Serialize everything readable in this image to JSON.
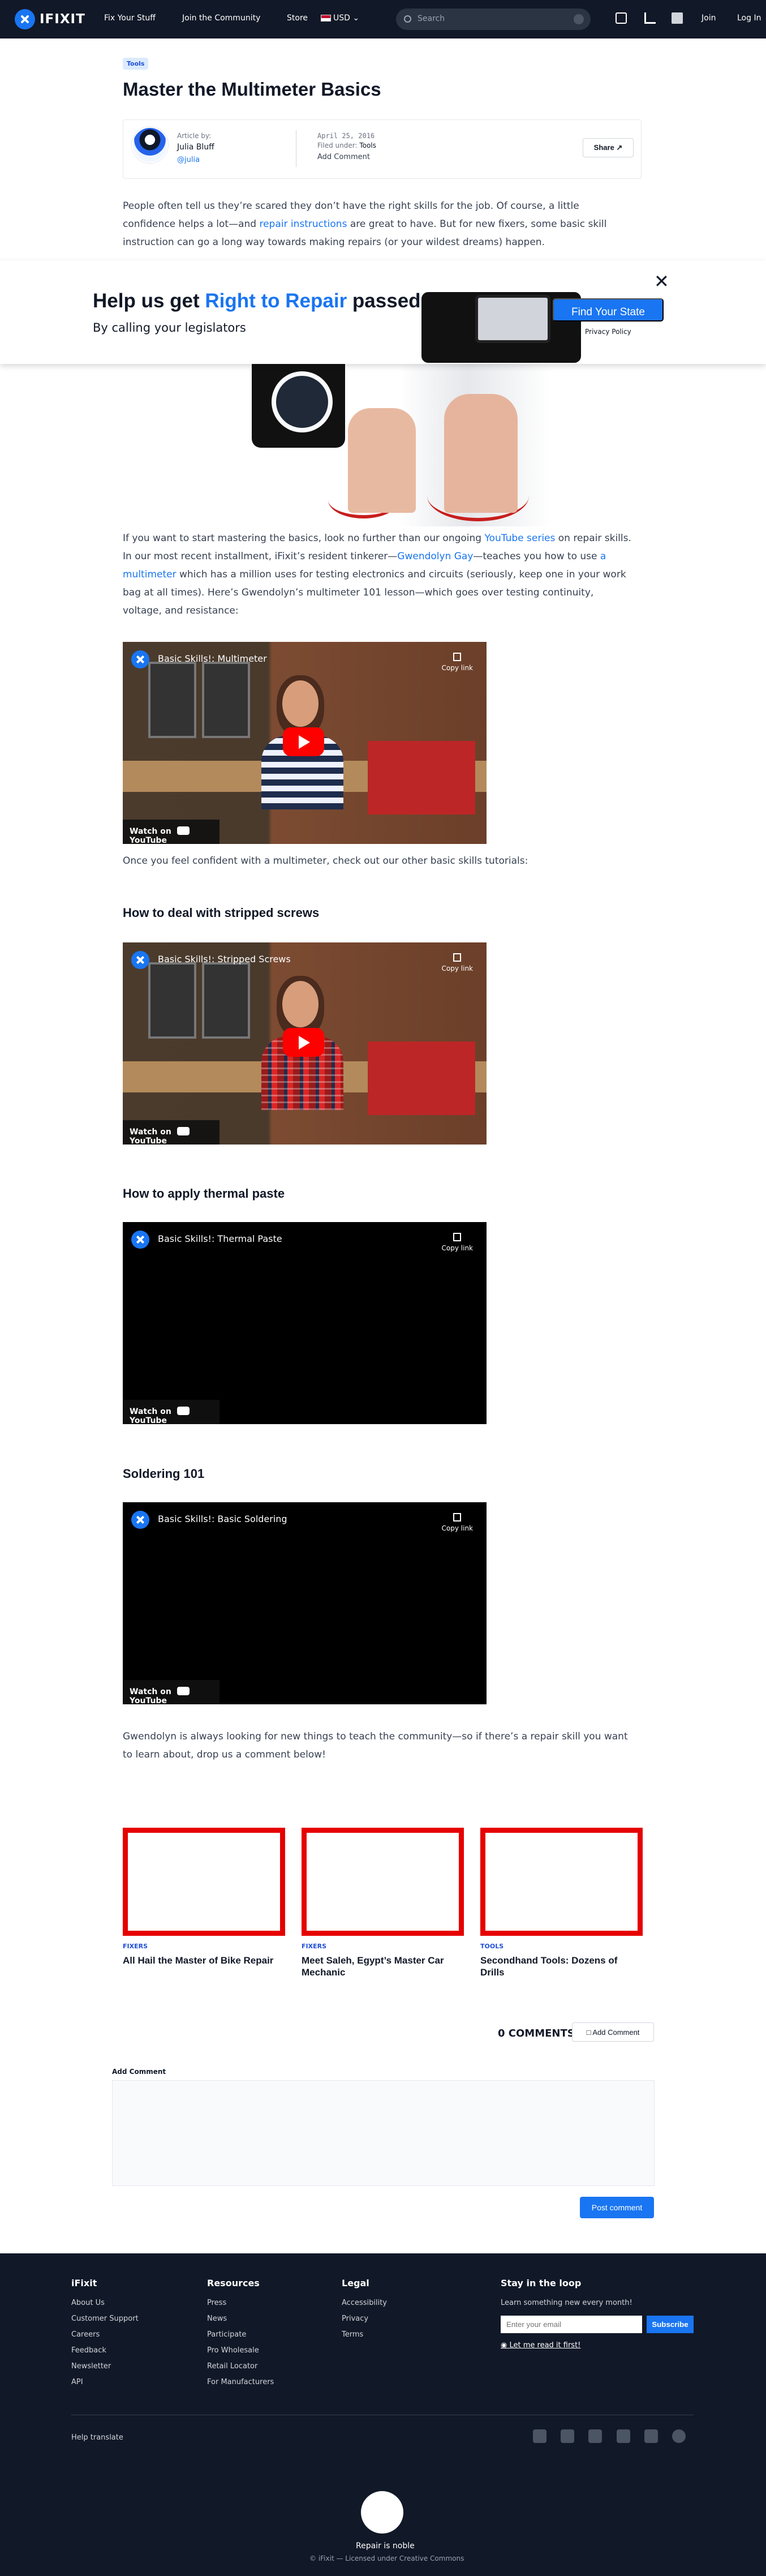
{
  "nav": {
    "brand": "IFIXIT",
    "fix": "Fix Your Stuff",
    "community": "Join the Community",
    "store": "Store",
    "currency": "USD",
    "search": "Search",
    "join": "Join",
    "login": "Log In"
  },
  "article": {
    "tag": "Tools",
    "title": "Master the Multimeter Basics",
    "article_by": "Article by:",
    "author": "Julia Bluff",
    "handle": "@julia",
    "date": "April 25, 2016",
    "filed": "Filed under:",
    "category": "Tools",
    "add_comment": "Add Comment",
    "share": "Share",
    "intro_1": "People often tell us they’re scared they don’t have the right skills for the job. Of course, a little confidence helps a lot—and ",
    "repair_link": "repair instructions",
    "intro_2": " are great to have. But for new fixers, some basic skill instruction can go a long way towards making repairs (or your wildest dreams) happen.",
    "para_1": "If you want to start mastering the basics, look no further than our ongoing ",
    "series_link": "YouTube series",
    "para_2": " on repair skills. In our most recent installment, iFixit’s resident tinkerer—",
    "gwen_link": "Gwendolyn Gay",
    "para_3": "—teaches you how to use ",
    "multi_link": "a multimeter",
    "para_4": " which has a million uses for testing electronics and circuits (seriously, keep one in your work bag at all times). Here’s Gwendolyn’s multimeter 101 lesson—which goes over testing continuity, voltage, and resistance:",
    "after_video": "Once you feel confident with a multimeter, check out our other basic skills tutorials:",
    "h_screws": "How to deal with stripped screws",
    "h_paste": "How to apply thermal paste",
    "h_solder": "Soldering 101",
    "closing": "Gwendolyn is always looking for new things to teach the community—so if there’s a repair skill you want to learn about, drop us a comment below!"
  },
  "banner": {
    "title_1": "Help us get ",
    "title_highlight": "Right to Repair",
    "title_2": " passed",
    "subtitle": "By calling your legislators",
    "cta": "Find Your State",
    "privacy": "Privacy Policy",
    "close": "✕"
  },
  "videos": [
    {
      "title": "Basic Skills!: Multimeter"
    },
    {
      "title": "Basic Skills!: Stripped Screws"
    },
    {
      "title": "Basic Skills!: Thermal Paste"
    },
    {
      "title": "Basic Skills!: Basic Soldering"
    }
  ],
  "video_ui": {
    "copy": "Copy link",
    "watch": "Watch on",
    "youtube": "YouTube"
  },
  "related": [
    {
      "tag": "FIXERS",
      "title": "All Hail the Master of Bike Repair"
    },
    {
      "tag": "FIXERS",
      "title": "Meet Saleh, Egypt’s Master Car Mechanic"
    },
    {
      "tag": "TOOLS",
      "title": "Secondhand Tools: Dozens of Drills"
    }
  ],
  "comments": {
    "count": "0 COMMENTS",
    "add": "Add Comment",
    "label": "Add Comment",
    "post": "Post comment"
  },
  "footer": {
    "ifixit": "iFixit",
    "ifixit_links": [
      "About Us",
      "Customer Support",
      "Careers",
      "Feedback",
      "Newsletter",
      "API"
    ],
    "resources": "Resources",
    "resource_links": [
      "Press",
      "News",
      "Participate",
      "Pro Wholesale",
      "Retail Locator",
      "For Manufacturers"
    ],
    "legal": "Legal",
    "legal_links": [
      "Accessibility",
      "Privacy",
      "Terms"
    ],
    "stay": "Stay in the loop",
    "stay_desc": "Learn something new every month!",
    "email": "Enter your email",
    "subscribe": "Subscribe",
    "read": "Let me read it first!",
    "translate": "Help translate",
    "tagline": "Repair is noble",
    "license": "© iFixit — Licensed under Creative Commons"
  }
}
